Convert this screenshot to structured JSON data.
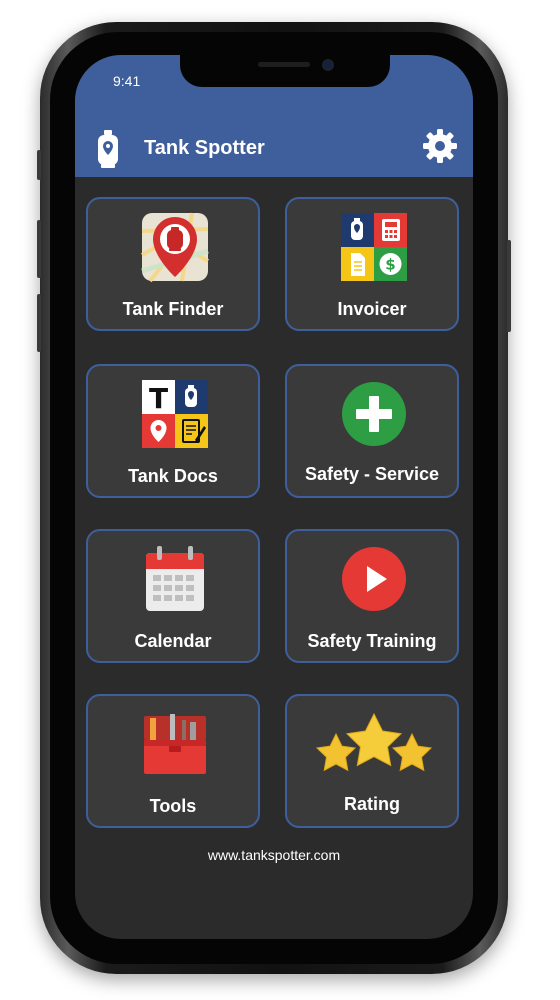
{
  "status_bar": {
    "time": "9:41"
  },
  "header": {
    "title": "Tank Spotter",
    "app_icon": "propane-tank-pin-icon",
    "settings_icon": "gear-icon"
  },
  "tiles": [
    {
      "label": "Tank Finder",
      "icon": "tank-finder-map-pin-icon"
    },
    {
      "label": "Invoicer",
      "icon": "invoicer-grid-icon"
    },
    {
      "label": "Tank Docs",
      "icon": "tank-docs-grid-icon"
    },
    {
      "label": "Safety - Service",
      "icon": "plus-circle-icon"
    },
    {
      "label": "Calendar",
      "icon": "calendar-icon"
    },
    {
      "label": "Safety Training",
      "icon": "play-circle-icon"
    },
    {
      "label": "Tools",
      "icon": "toolbox-icon"
    },
    {
      "label": "Rating",
      "icon": "stars-icon"
    }
  ],
  "footer": {
    "link": "www.tankspotter.com"
  },
  "colors": {
    "header_bg": "#3e5f9b",
    "screen_bg": "#2b2b2b",
    "tile_bg": "#3a3a3a",
    "tile_border": "#3e5f9b",
    "red": "#e53935",
    "green": "#2e9e44",
    "navy": "#1f3a6e",
    "yellow": "#f5c518",
    "star": "#f2c230"
  }
}
